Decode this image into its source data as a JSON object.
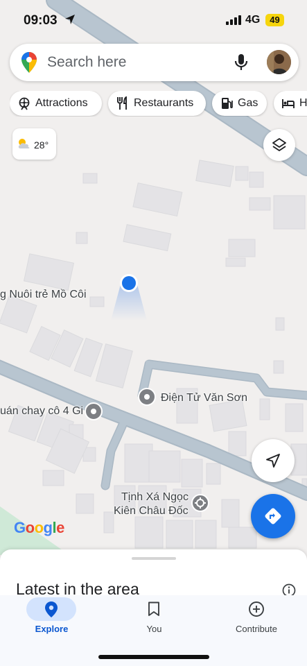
{
  "status_bar": {
    "time": "09:03",
    "network": "4G",
    "battery": "49"
  },
  "search": {
    "placeholder": "Search here"
  },
  "chips": [
    {
      "label": "Attractions",
      "icon": "attractions-icon"
    },
    {
      "label": "Restaurants",
      "icon": "restaurant-icon"
    },
    {
      "label": "Gas",
      "icon": "gas-station-icon"
    },
    {
      "label": "H",
      "icon": "hotel-icon"
    }
  ],
  "weather": {
    "temperature": "28°",
    "icon": "partly-cloudy-icon"
  },
  "map": {
    "labels": {
      "orphanage": "g Nuôi trẻ Mồ Côi",
      "electronics": "Điện Tử Văn Sơn",
      "vegetarian": "uán chay cô 4 Gi",
      "temple_line1": "Tịnh Xá Ngọc",
      "temple_line2": "Kiên Châu Đốc"
    },
    "attribution": "Google"
  },
  "sheet": {
    "title": "Latest in the area"
  },
  "nav": {
    "explore": "Explore",
    "you": "You",
    "contribute": "Contribute"
  },
  "colors": {
    "accent": "#1a73e8",
    "map_background": "#f1efee",
    "building": "#e3e3e5",
    "road": "#a9b9c6",
    "location_dot": "#1a73e8"
  }
}
